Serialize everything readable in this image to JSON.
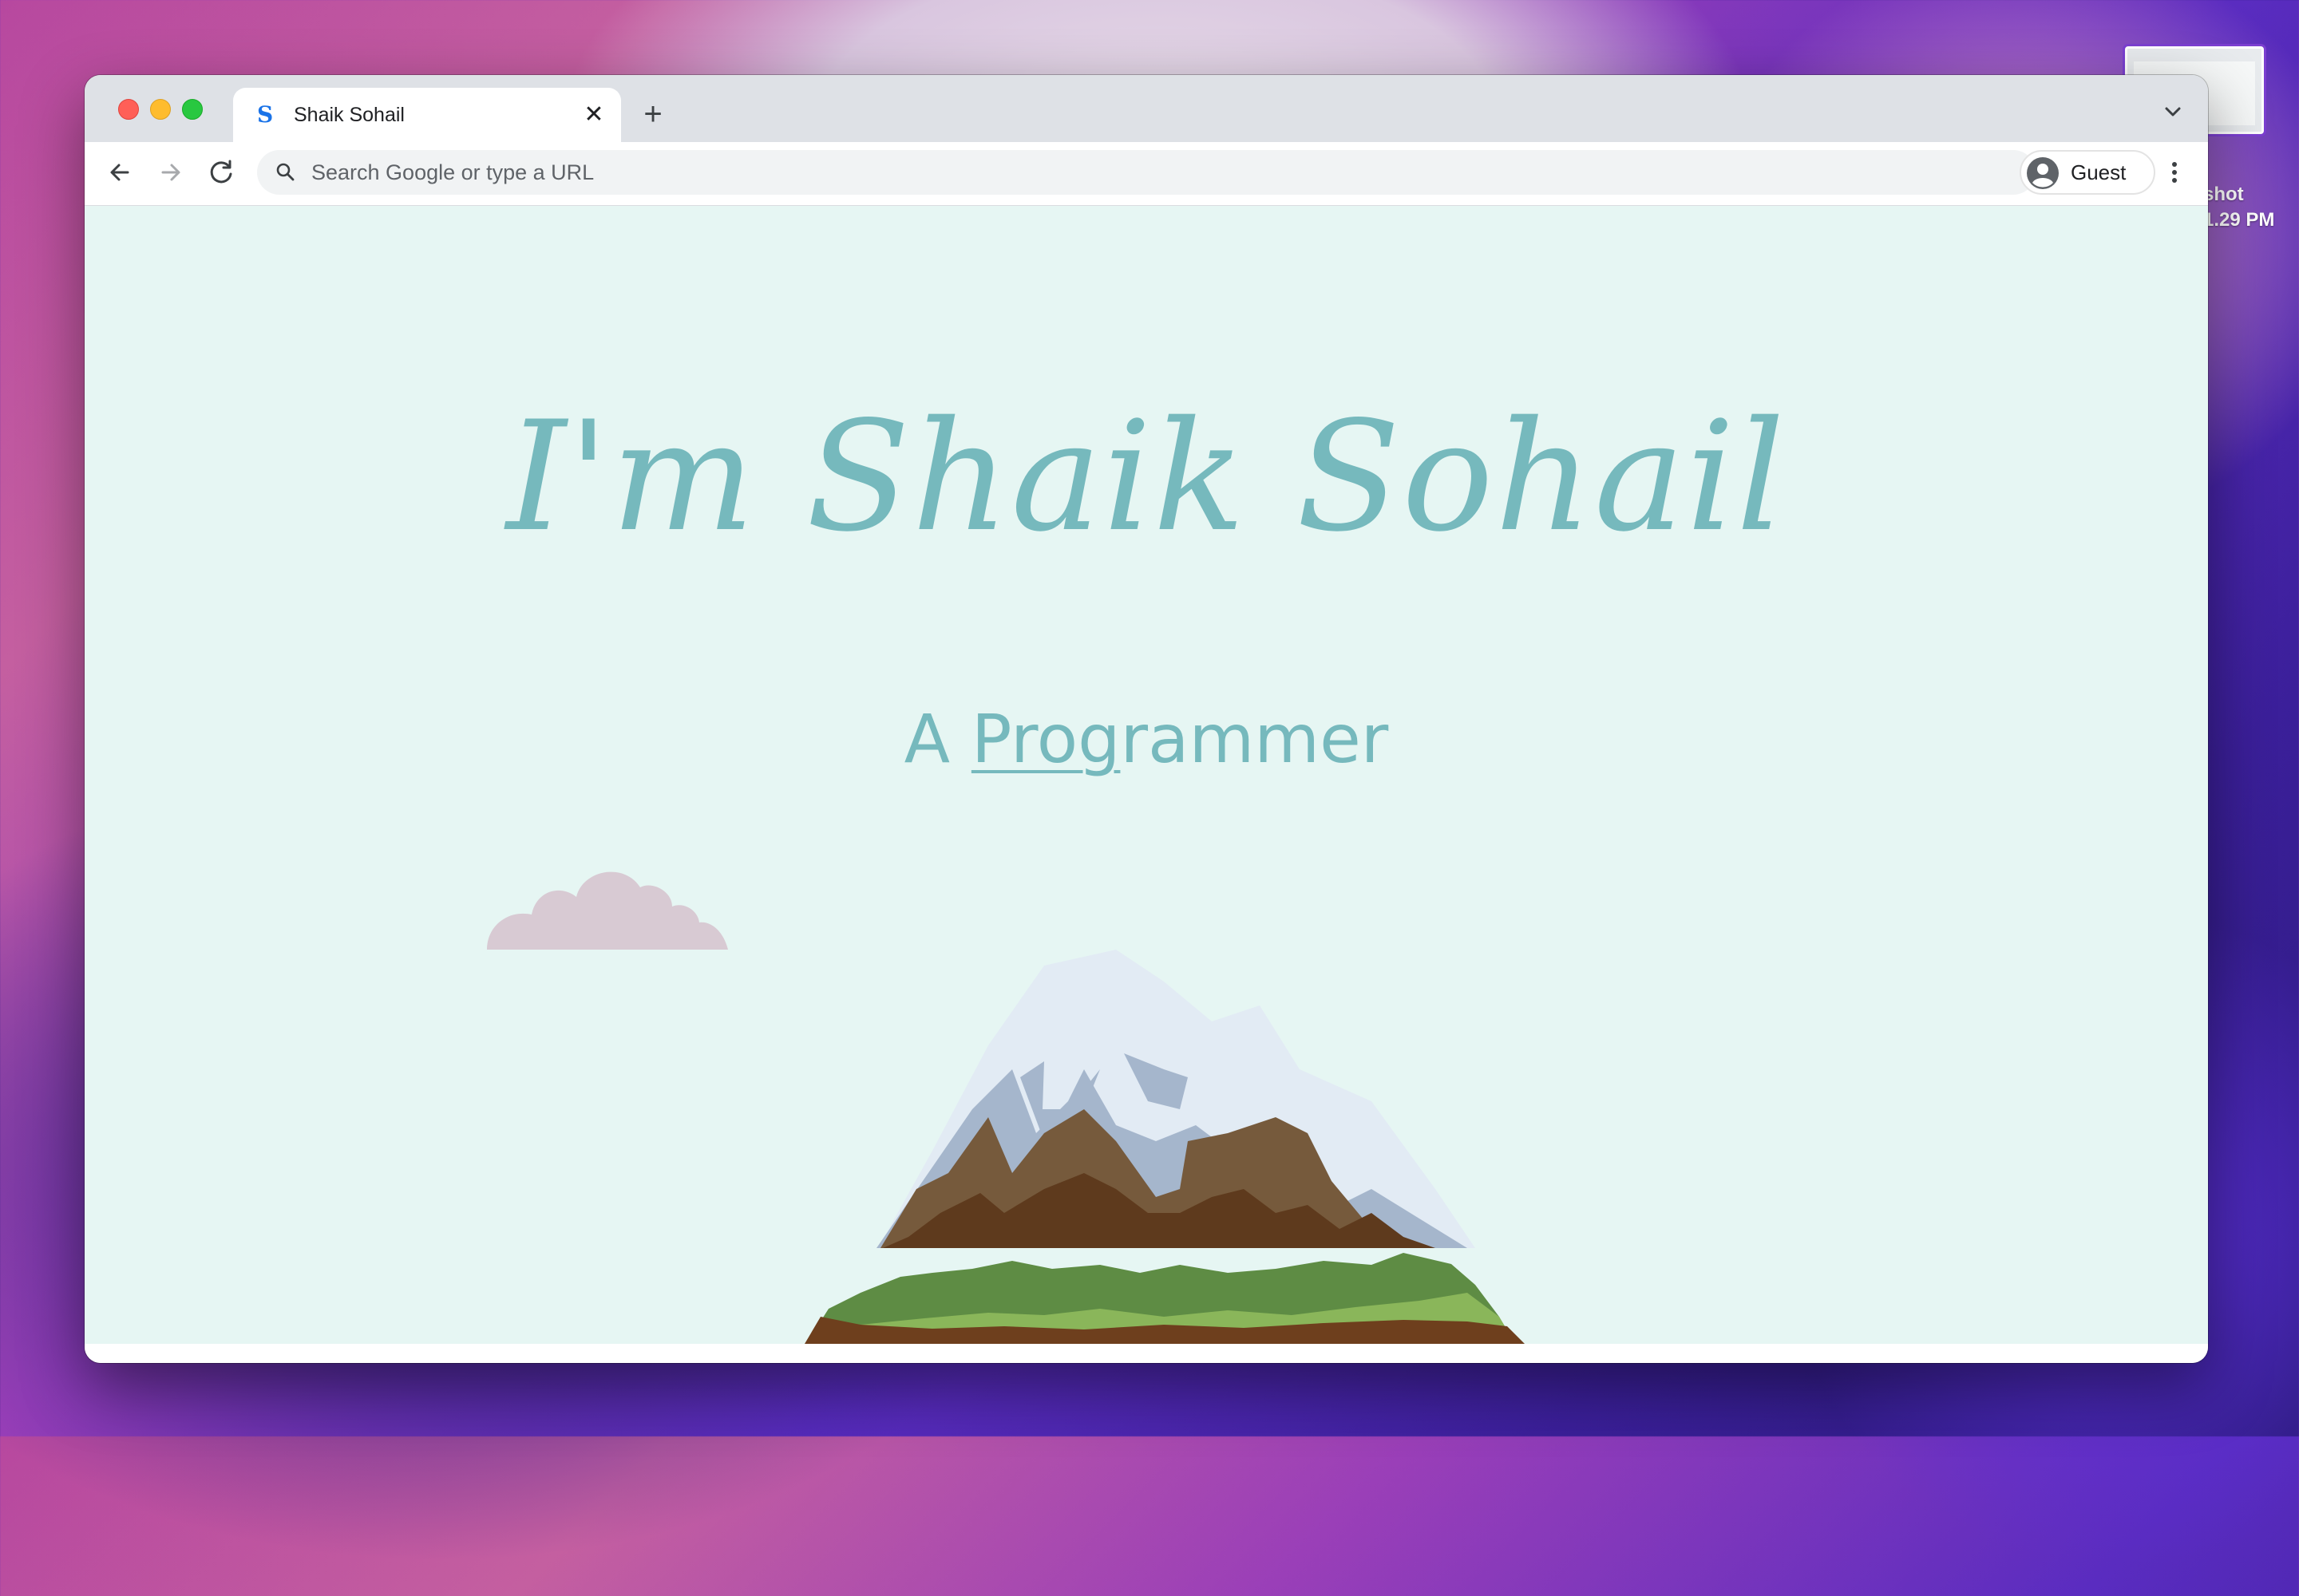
{
  "desktop": {
    "screenshot_label_line1": "shot",
    "screenshot_label_line2": "1.29 PM"
  },
  "browser": {
    "tab": {
      "title": "Shaik Sohail",
      "favicon_glyph": "S"
    },
    "new_tab_symbol": "+",
    "close_symbol": "✕",
    "omnibox": {
      "placeholder": "Search Google or type a URL"
    },
    "profile": {
      "label": "Guest"
    }
  },
  "page": {
    "title": "I'm Shaik Sohail",
    "subtitle_prefix": "A ",
    "subtitle_typed": "Prog",
    "subtitle_rest": "rammer"
  },
  "colors": {
    "page_background": "#e6f6f3",
    "accent_text": "#76b9bd",
    "cloud": "#d8cad3",
    "snow": "#e2ebf4",
    "rock_shadow": "#a5b6cc",
    "rock_light": "#765a3c",
    "rock_dark": "#5e3a1d",
    "grass_dark": "#5e8c44",
    "grass_light": "#8ab65a",
    "soil": "#6e3f1d"
  },
  "icons": {
    "back": "arrow-left-icon",
    "forward": "arrow-right-icon",
    "reload": "reload-icon",
    "search": "search-icon",
    "side_panel": "side-panel-icon",
    "avatar": "avatar-icon",
    "menu": "kebab-menu-icon",
    "tab_list": "chevron-down-icon"
  }
}
